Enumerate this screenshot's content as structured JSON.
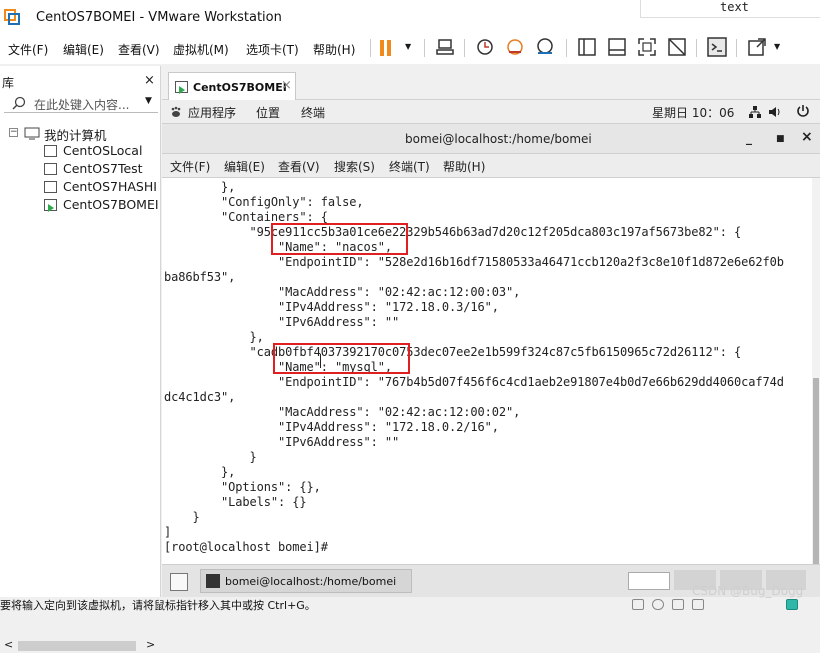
{
  "window": {
    "title": "CentOS7BOMEI - VMware Workstation"
  },
  "floating_text": "text",
  "menu": [
    "文件(F)",
    "编辑(E)",
    "查看(V)",
    "虚拟机(M)",
    "选项卡(T)",
    "帮助(H)"
  ],
  "library": {
    "title": "库",
    "close": "×",
    "search_placeholder": "在此处键入内容...",
    "root": "我的计算机",
    "vms": [
      "CentOSLocal",
      "CentOS7Test",
      "CentOS7HASHI",
      "CentOS7BOMEI"
    ],
    "scroll_left": "<",
    "scroll_right": ">"
  },
  "tab": {
    "label": "CentOS7BOMEI",
    "close": "×"
  },
  "gnome": {
    "apps": "应用程序",
    "places": "位置",
    "terminal": "终端",
    "clock": "星期日 10：06"
  },
  "terminal": {
    "title": "bomei@localhost:/home/bomei",
    "menu": [
      "文件(F)",
      "编辑(E)",
      "查看(V)",
      "搜索(S)",
      "终端(T)",
      "帮助(H)"
    ],
    "lines": [
      "        },",
      "        \"ConfigOnly\": false,",
      "        \"Containers\": {",
      "            \"95ce911cc5b3a01ce6e22329b546b63ad7d20c12f205dca803c197af5673be82\": {",
      "                \"Name\": \"nacos\",",
      "                \"EndpointID\": \"528e2d16b16df71580533a46471ccb120a2f3c8e10f1d872e6e62f0b",
      "ba86bf53\",",
      "                \"MacAddress\": \"02:42:ac:12:00:03\",",
      "                \"IPv4Address\": \"172.18.0.3/16\",",
      "                \"IPv6Address\": \"\"",
      "            },",
      "            \"cadb0fbf4037392170c0753dec07ee2e1b599f324c87c5fb6150965c72d26112\": {",
      "                \"Name\": \"mysql\",",
      "                \"EndpointID\": \"767b4b5d07f456f6c4cd1aeb2e91807e4b0d7e66b629dd4060caf74d",
      "dc4c1dc3\",",
      "                \"MacAddress\": \"02:42:ac:12:00:02\",",
      "                \"IPv4Address\": \"172.18.0.2/16\",",
      "                \"IPv6Address\": \"\"",
      "            }",
      "        },",
      "        \"Options\": {},",
      "        \"Labels\": {}",
      "    }",
      "]",
      "[root@localhost bomei]# "
    ]
  },
  "taskbar": {
    "task_label": "bomei@localhost:/home/bomei"
  },
  "status": "要将输入定向到该虚拟机，请将鼠标指针移入其中或按 Ctrl+G。",
  "watermark": "CSDN @Bug_Dogg",
  "colors": {
    "highlight": "#e02020",
    "pause": "#f08a1c",
    "run": "#2fa84f"
  }
}
